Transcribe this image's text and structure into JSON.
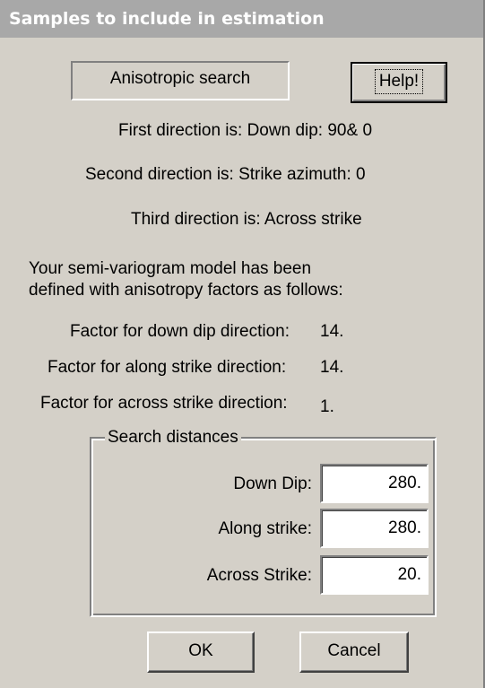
{
  "window": {
    "title": "Samples to include in estimation"
  },
  "search_type": "Anisotropic search",
  "help_button": "Help!",
  "directions": {
    "first": "First direction is: Down dip:  90& 0",
    "second": "Second direction is: Strike azimuth:   0",
    "third": "Third direction is: Across strike"
  },
  "model_note": {
    "line1": "Your semi-variogram model has been",
    "line2": "defined with anisotropy factors as follows:"
  },
  "factors": [
    {
      "label": "Factor for down dip direction:",
      "value": "14."
    },
    {
      "label": "Factor for along strike direction:",
      "value": "14."
    },
    {
      "label": "Factor for across strike direction:",
      "value": "1."
    }
  ],
  "search_distances": {
    "title": "Search distances",
    "fields": [
      {
        "label": "Down Dip:",
        "value": "280."
      },
      {
        "label": "Along strike:",
        "value": "280."
      },
      {
        "label": "Across Strike:",
        "value": "20."
      }
    ]
  },
  "buttons": {
    "ok": "OK",
    "cancel": "Cancel"
  }
}
